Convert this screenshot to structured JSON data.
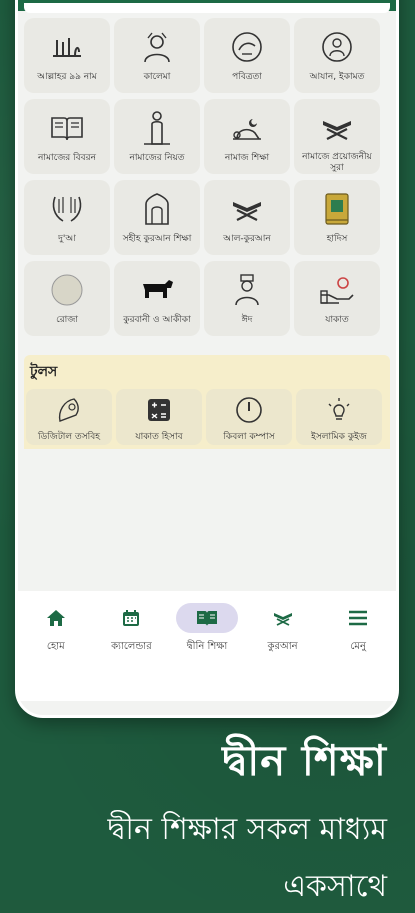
{
  "grid": [
    {
      "label": "আল্লাহর ৯৯ নাম",
      "icon": "allah-calligraphy-icon"
    },
    {
      "label": "কালেমা",
      "icon": "kalema-icon"
    },
    {
      "label": "পবিত্রতা",
      "icon": "purity-icon"
    },
    {
      "label": "আযান, ইকামত",
      "icon": "azan-icon"
    },
    {
      "label": "নামাজের বিবরন",
      "icon": "open-book-icon"
    },
    {
      "label": "নামাজের নিয়ত",
      "icon": "praying-man-icon"
    },
    {
      "label": "নামাজ শিক্ষা",
      "icon": "prostration-icon"
    },
    {
      "label": "নামাজে প্রয়োজনীয় সুরা",
      "icon": "quran-stand-icon"
    },
    {
      "label": "দু'আ",
      "icon": "dua-hands-icon"
    },
    {
      "label": "সহীহ কুরআন শিক্ষা",
      "icon": "mihrab-icon"
    },
    {
      "label": "আল-কুরআন",
      "icon": "quran-stand-icon"
    },
    {
      "label": "হাদিস",
      "icon": "hadith-book-icon"
    },
    {
      "label": "রোজা",
      "icon": "crescent-moon-icon"
    },
    {
      "label": "কুরবানী ও আকীকা",
      "icon": "cow-icon"
    },
    {
      "label": "ঈদ",
      "icon": "eid-person-icon"
    },
    {
      "label": "যাকাত",
      "icon": "zakat-hand-icon"
    }
  ],
  "tools": {
    "heading": "টুলস",
    "items": [
      {
        "label": "ডিজিটাল তসবিহ",
        "icon": "tasbih-icon"
      },
      {
        "label": "যাকাত হিসাব",
        "icon": "calculator-icon"
      },
      {
        "label": "কিবলা কম্পাস",
        "icon": "compass-icon"
      },
      {
        "label": "ইসলামিক কুইজ",
        "icon": "lightbulb-icon"
      }
    ]
  },
  "nav": [
    {
      "label": "হোম",
      "icon": "home-icon",
      "active": false
    },
    {
      "label": "ক্যালেন্ডার",
      "icon": "calendar-icon",
      "active": false
    },
    {
      "label": "দ্বীনি শিক্ষা",
      "icon": "book-icon",
      "active": true
    },
    {
      "label": "কুরআন",
      "icon": "quran-stand-icon",
      "active": false
    },
    {
      "label": "মেনু",
      "icon": "menu-icon",
      "active": false
    }
  ],
  "hero": {
    "title": "দ্বীন শিক্ষা",
    "line1": "দ্বীন শিক্ষার সকল মাধ্যম",
    "line2": "একসাথে"
  },
  "colors": {
    "green": "#1d6a45",
    "tile": "#e9e9e4",
    "tools_bg": "#f6eecb",
    "active_pill": "#dcd9ee"
  }
}
